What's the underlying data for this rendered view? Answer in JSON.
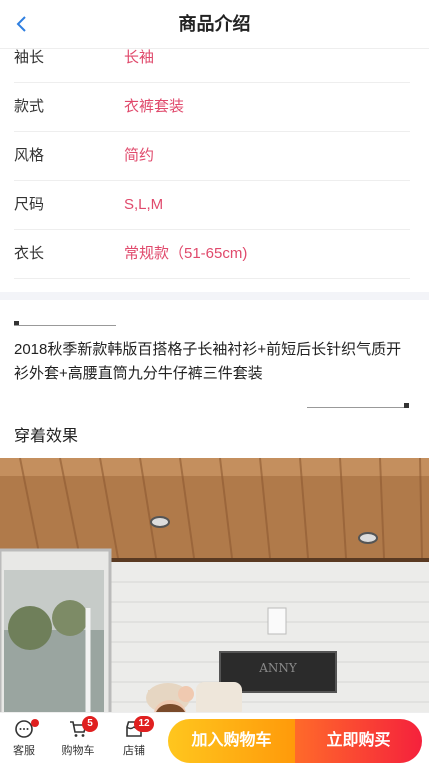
{
  "header": {
    "title": "商品介绍"
  },
  "specs": [
    {
      "label": "袖长",
      "value": "长袖"
    },
    {
      "label": "款式",
      "value": "衣裤套装"
    },
    {
      "label": "风格",
      "value": "简约"
    },
    {
      "label": "尺码",
      "value": "S,L,M"
    },
    {
      "label": "衣长",
      "value": "常规款（51-65cm)"
    }
  ],
  "description": "2018秋季新款韩版百搭格子长袖衬衫+前短后长针织气质开衫外套+高腰直筒九分牛仔裤三件套装",
  "wear_title": "穿着效果",
  "photo": {
    "sign_text": "ANNY"
  },
  "bottom": {
    "service_label": "客服",
    "cart_label": "购物车",
    "cart_badge": "5",
    "store_label": "店铺",
    "store_badge": "12",
    "add_cart": "加入购物车",
    "buy_now": "立即购买"
  },
  "colors": {
    "accent": "#e04a6c",
    "badge": "#e02020",
    "back": "#2f7fe0"
  }
}
